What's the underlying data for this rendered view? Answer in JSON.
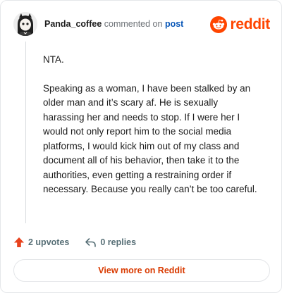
{
  "header": {
    "username": "Panda_coffee",
    "action_text": "commented on",
    "post_link": "post",
    "brand": "reddit",
    "brand_color": "#ff4500"
  },
  "comment": {
    "paragraphs": [
      "NTA.",
      "Speaking as a woman, I have been stalked by an older man and it’s scary af. He is sexually harassing her and needs to stop. If I were her I would not only report him to the social media platforms, I would kick him out of my class and document all of his behavior, then take it to the authorities, even getting a restraining order if necessary. Because you really can’t be too careful."
    ]
  },
  "stats": {
    "upvotes_label": "2 upvotes",
    "upvote_icon": "upvote-arrow-icon",
    "upvote_color": "#e8431e",
    "replies_label": "0 replies",
    "reply_icon": "reply-arrow-icon"
  },
  "footer": {
    "view_more_label": "View more on Reddit"
  }
}
